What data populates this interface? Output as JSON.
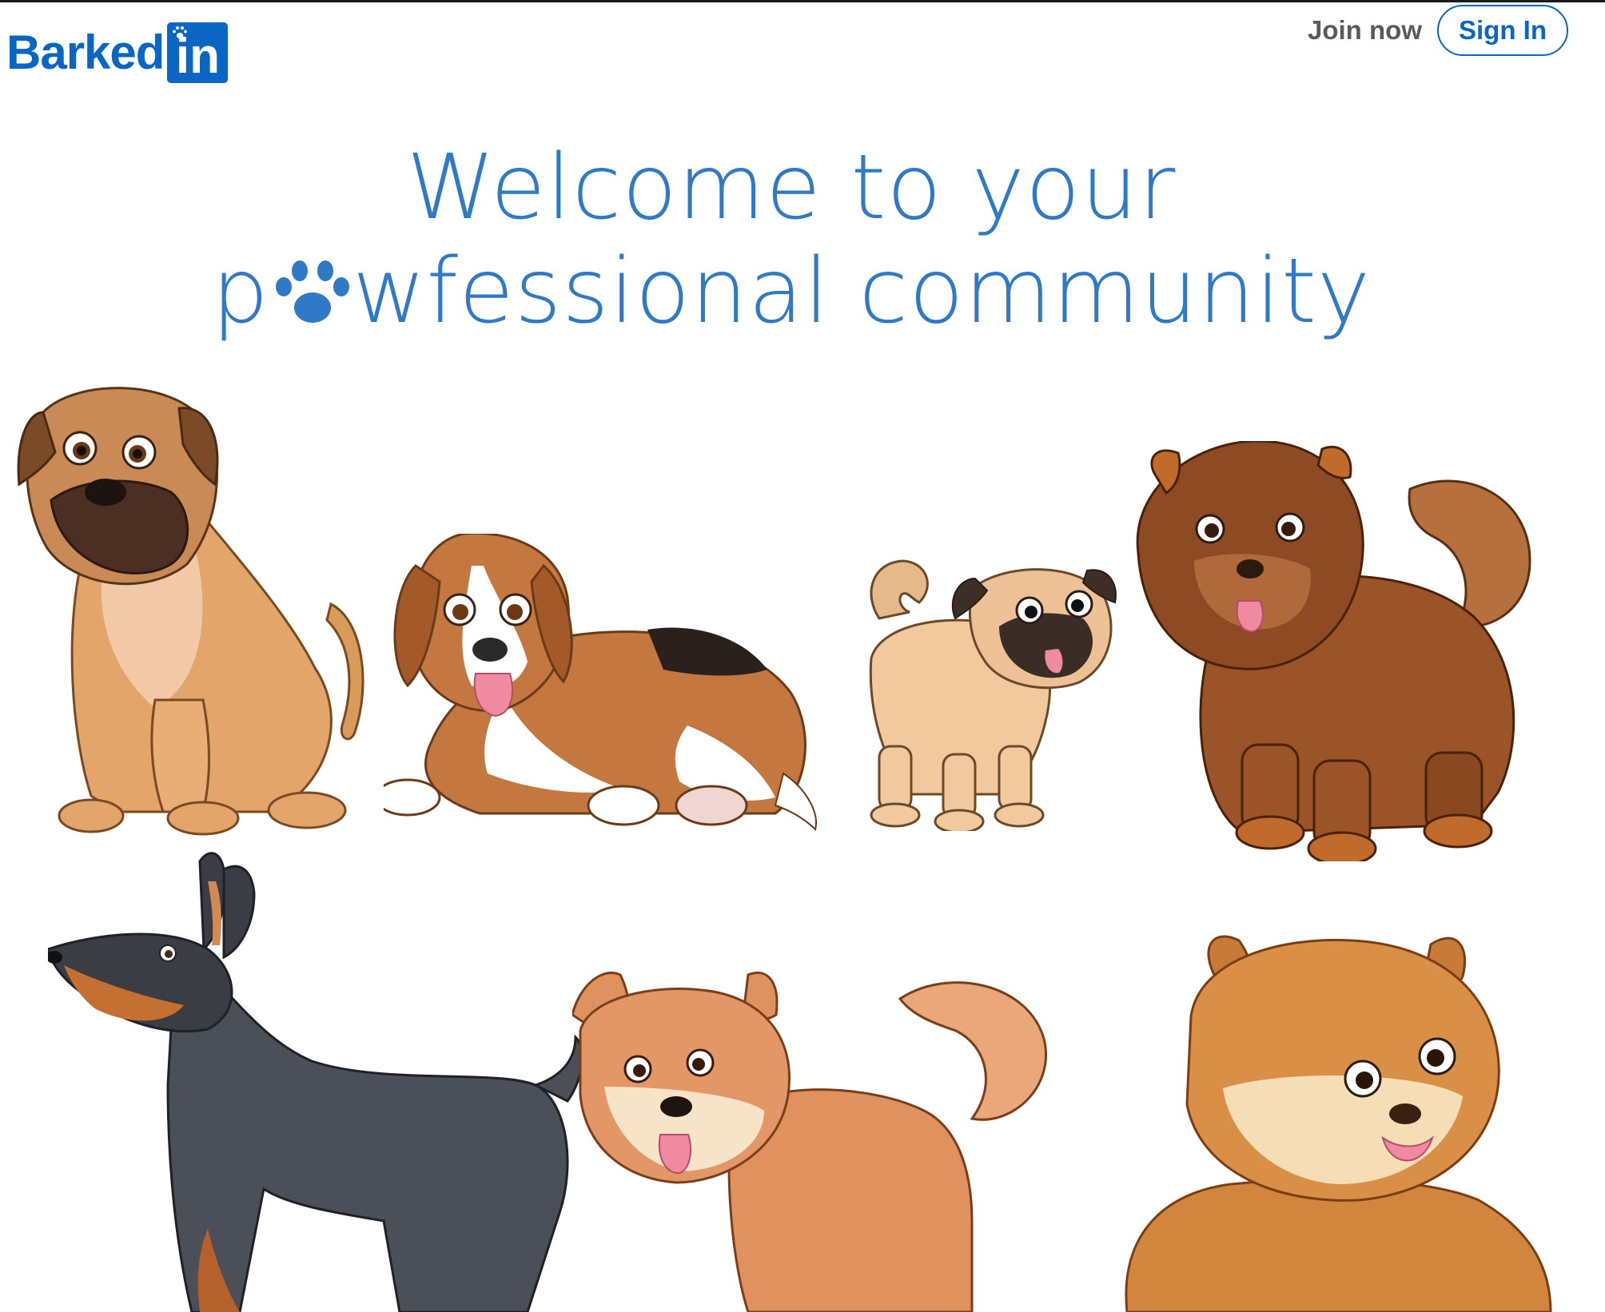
{
  "brand": {
    "logo_word": "Barked",
    "logo_box_text": "in",
    "color": "#0a66c2"
  },
  "nav": {
    "join_label": "Join now",
    "signin_label": "Sign In"
  },
  "headline": {
    "line1": "Welcome to your",
    "line2_prefix": "p",
    "line2_paw_icon": "paw-icon",
    "line2_suffix": "wfessional community",
    "color": "#2f79c7"
  },
  "illustrations": [
    {
      "name": "boxer-mastiff-dog-illustration"
    },
    {
      "name": "beagle-dog-illustration"
    },
    {
      "name": "pug-dog-illustration"
    },
    {
      "name": "chow-chow-dog-illustration"
    },
    {
      "name": "doberman-dog-illustration"
    },
    {
      "name": "shiba-inu-dog-illustration"
    },
    {
      "name": "pomeranian-dog-illustration"
    }
  ]
}
